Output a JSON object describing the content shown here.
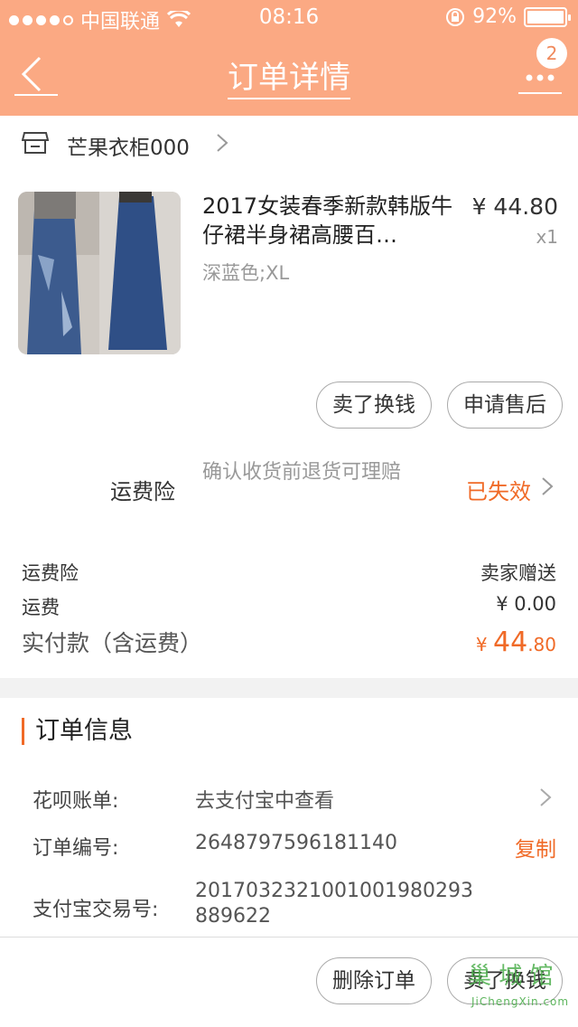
{
  "status_bar": {
    "carrier": "中国联通",
    "time": "08:16",
    "battery": "92%"
  },
  "nav": {
    "title": "订单详情",
    "badge": "2"
  },
  "shop": {
    "name": "芒果衣柜000"
  },
  "product": {
    "title": "2017女装春季新款韩版牛仔裙半身裙高腰百…",
    "price": "¥ 44.80",
    "quantity": "x1",
    "sku": "深蓝色;XL",
    "buttons": [
      "卖了换钱",
      "申请售后"
    ]
  },
  "insurance": {
    "label": "运费险",
    "description": "确认收货前退货可理赔",
    "status": "已失效"
  },
  "fees": {
    "insurance_label": "运费险",
    "insurance_value": "卖家赠送",
    "shipping_label": "运费",
    "shipping_value": "¥ 0.00",
    "total_label": "实付款（含运费）",
    "total_currency": "¥ ",
    "total_int": "44",
    "total_dec": ".80"
  },
  "order_info": {
    "title": "订单信息",
    "rows": [
      {
        "label": "花呗账单:",
        "value": "去支付宝中查看"
      },
      {
        "label": "订单编号:",
        "value": "2648797596181140",
        "action": "复制"
      },
      {
        "label": "支付宝交易号:",
        "value": "2017032321001001980293889622"
      }
    ]
  },
  "bottom_bar": {
    "buttons": [
      "删除订单",
      "卖了换钱"
    ]
  },
  "watermark": {
    "main": "巢 城 馆",
    "sub": "JiChengXin.com"
  },
  "colors": {
    "header_bg": "#fba983",
    "accent": "#f06a27"
  }
}
